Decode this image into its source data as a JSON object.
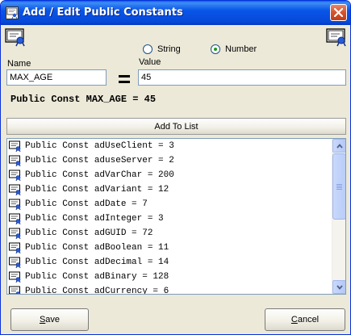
{
  "window": {
    "title": "Add / Edit Public Constants"
  },
  "type_options": [
    {
      "label": "String",
      "selected": false
    },
    {
      "label": "Number",
      "selected": true
    }
  ],
  "fields": {
    "name_label": "Name",
    "value_label": "Value",
    "name_value": "MAX_AGE",
    "value_value": "45",
    "equals_sign": "="
  },
  "preview": "Public Const MAX_AGE = 45",
  "buttons": {
    "add_to_list": "Add To List",
    "save_prefix": "",
    "save_accel": "S",
    "save_rest": "ave",
    "cancel_prefix": "",
    "cancel_accel": "C",
    "cancel_rest": "ancel"
  },
  "constants": [
    "Public Const adUseClient = 3",
    "Public Const aduseServer = 2",
    "Public Const adVarChar = 200",
    "Public Const adVariant = 12",
    "Public Const adDate = 7",
    "Public Const adInteger = 3",
    "Public Const adGUID = 72",
    "Public Const adBoolean = 11",
    "Public Const adDecimal = 14",
    "Public Const adBinary = 128",
    "Public Const adCurrency = 6"
  ],
  "icons": {
    "window": "certificate-icon",
    "header_left": "certificate-icon",
    "header_right": "certificate-icon",
    "list_item": "certificate-icon"
  },
  "colors": {
    "titlebar": "#0a5fe8",
    "dialog_bg": "#ece9d8",
    "close_button": "#d4542e",
    "radio_dot": "#1a9a1a",
    "field_border": "#7f9db9"
  }
}
